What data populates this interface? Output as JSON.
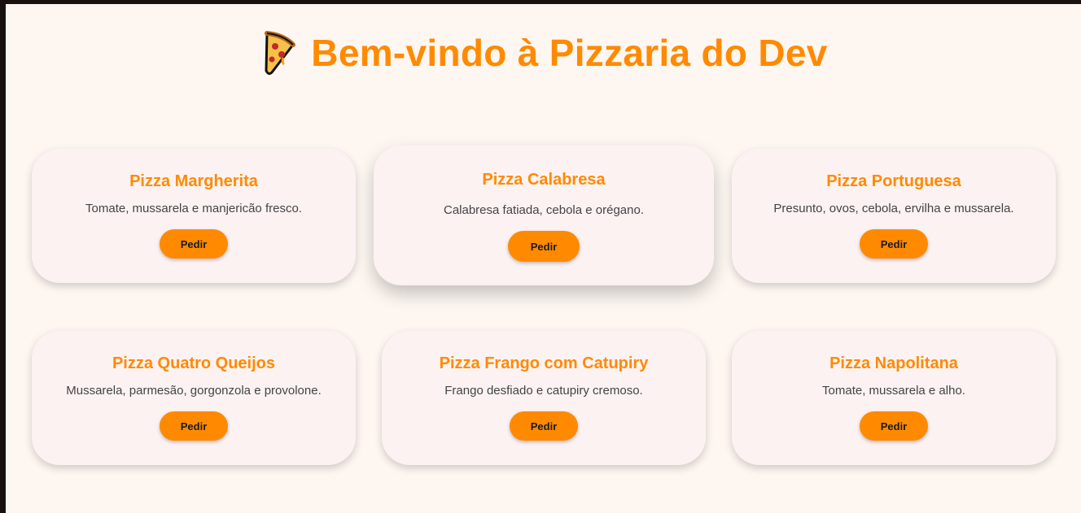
{
  "header": {
    "title": "Bem-vindo à Pizzaria do Dev",
    "icon": "pizza-slice-icon"
  },
  "colors": {
    "accent": "#ff8a00",
    "background": "#fdf6f1",
    "card": "#fdf2f2",
    "text": "#444444"
  },
  "pizzas": [
    {
      "name": "Pizza Margherita",
      "description": "Tomate, mussarela e manjericão fresco.",
      "button": "Pedir"
    },
    {
      "name": "Pizza Calabresa",
      "description": "Calabresa fatiada, cebola e orégano.",
      "button": "Pedir"
    },
    {
      "name": "Pizza Portuguesa",
      "description": "Presunto, ovos, cebola, ervilha e mussarela.",
      "button": "Pedir"
    },
    {
      "name": "Pizza Quatro Queijos",
      "description": "Mussarela, parmesão, gorgonzola e provolone.",
      "button": "Pedir"
    },
    {
      "name": "Pizza Frango com Catupiry",
      "description": "Frango desfiado e catupiry cremoso.",
      "button": "Pedir"
    },
    {
      "name": "Pizza Napolitana",
      "description": "Tomate, mussarela e alho.",
      "button": "Pedir"
    }
  ]
}
